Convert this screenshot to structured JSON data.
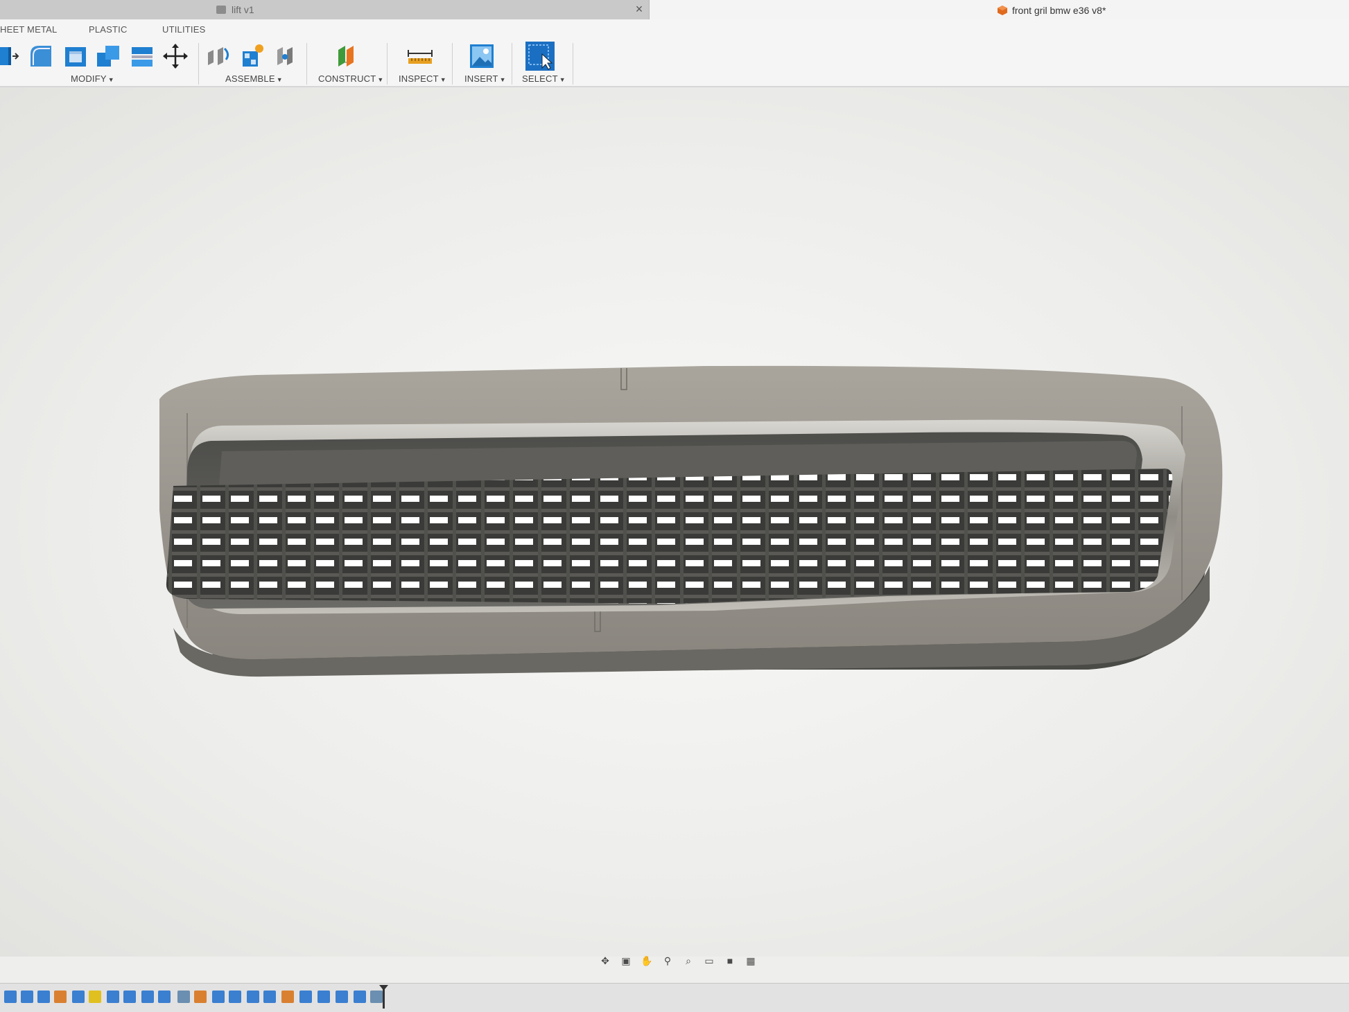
{
  "tabs": {
    "inactive": {
      "title": "lift v1",
      "close_glyph": "×"
    },
    "active": {
      "title": "front gril bmw e36 v8*"
    }
  },
  "workspace_tabs": [
    "HEET METAL",
    "PLASTIC",
    "UTILITIES"
  ],
  "toolbar_groups": {
    "modify": "MODIFY",
    "assemble": "ASSEMBLE",
    "construct": "CONSTRUCT",
    "inspect": "INSPECT",
    "insert": "INSERT",
    "select": "SELECT"
  },
  "icons": {
    "modify": [
      "press-pull-icon",
      "fillet-icon",
      "shell-icon",
      "combine-icon",
      "split-body-icon",
      "move-icon"
    ],
    "assemble": [
      "joint-icon",
      "new-component-icon",
      "as-built-joint-icon"
    ],
    "construct": [
      "offset-plane-icon"
    ],
    "inspect": [
      "measure-icon"
    ],
    "insert": [
      "insert-image-icon"
    ],
    "select": [
      "select-icon"
    ],
    "navigation": [
      "orbit-icon",
      "look-at-icon",
      "pan-icon",
      "zoom-icon",
      "fit-icon",
      "display-settings-icon",
      "visual-style-icon",
      "grid-icon"
    ]
  },
  "colors": {
    "accent_blue": "#1f7fd0",
    "select_blue": "#1b6fc2",
    "construct_orange": "#e8741f",
    "construct_green": "#3f9b3a",
    "doc_orange": "#e06a1e",
    "model_body": "#8d8a84",
    "model_dark": "#4a4a47"
  }
}
